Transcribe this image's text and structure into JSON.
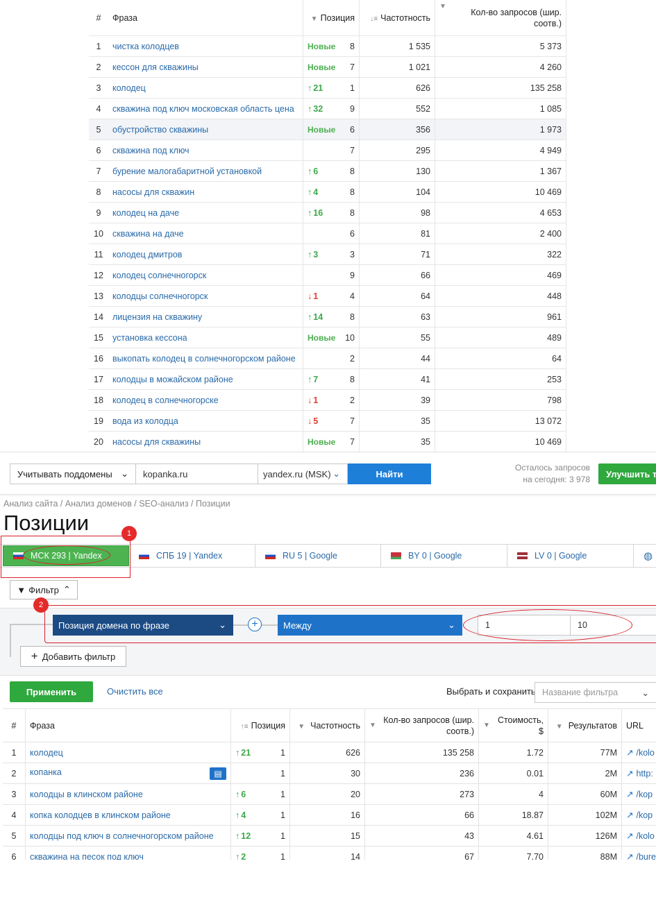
{
  "top_table": {
    "headers": {
      "num": "#",
      "phrase": "Фраза",
      "position": "Позиция",
      "frequency": "Частотность",
      "requests": "Кол-во запросов (шир. соотв.)"
    },
    "rows": [
      {
        "n": "1",
        "phrase": "чистка колодцев",
        "change": "Новые",
        "kind": "new",
        "pos": "8",
        "freq": "1 535",
        "req": "5 373"
      },
      {
        "n": "2",
        "phrase": "кессон для скважины",
        "change": "Новые",
        "kind": "new",
        "pos": "7",
        "freq": "1 021",
        "req": "4 260"
      },
      {
        "n": "3",
        "phrase": "колодец",
        "change": "21",
        "kind": "up",
        "pos": "1",
        "freq": "626",
        "req": "135 258"
      },
      {
        "n": "4",
        "phrase": "скважина под ключ московская область цена",
        "change": "32",
        "kind": "up",
        "pos": "9",
        "freq": "552",
        "req": "1 085"
      },
      {
        "n": "5",
        "phrase": "обустройство скважины",
        "change": "Новые",
        "kind": "new",
        "pos": "6",
        "freq": "356",
        "req": "1 973",
        "hl": true
      },
      {
        "n": "6",
        "phrase": "скважина под ключ",
        "change": "",
        "kind": "none",
        "pos": "7",
        "freq": "295",
        "req": "4 949"
      },
      {
        "n": "7",
        "phrase": "бурение малогабаритной установкой",
        "change": "6",
        "kind": "up",
        "pos": "8",
        "freq": "130",
        "req": "1 367"
      },
      {
        "n": "8",
        "phrase": "насосы для скважин",
        "change": "4",
        "kind": "up",
        "pos": "8",
        "freq": "104",
        "req": "10 469"
      },
      {
        "n": "9",
        "phrase": "колодец на даче",
        "change": "16",
        "kind": "up",
        "pos": "8",
        "freq": "98",
        "req": "4 653"
      },
      {
        "n": "10",
        "phrase": "скважина на даче",
        "change": "",
        "kind": "none",
        "pos": "6",
        "freq": "81",
        "req": "2 400"
      },
      {
        "n": "11",
        "phrase": "колодец дмитров",
        "change": "3",
        "kind": "up",
        "pos": "3",
        "freq": "71",
        "req": "322"
      },
      {
        "n": "12",
        "phrase": "колодец солнечногорск",
        "change": "",
        "kind": "none",
        "pos": "9",
        "freq": "66",
        "req": "469"
      },
      {
        "n": "13",
        "phrase": "колодцы солнечногорск",
        "change": "1",
        "kind": "down",
        "pos": "4",
        "freq": "64",
        "req": "448"
      },
      {
        "n": "14",
        "phrase": "лицензия на скважину",
        "change": "14",
        "kind": "up",
        "pos": "8",
        "freq": "63",
        "req": "961"
      },
      {
        "n": "15",
        "phrase": "установка кессона",
        "change": "Новые",
        "kind": "new",
        "pos": "10",
        "freq": "55",
        "req": "489"
      },
      {
        "n": "16",
        "phrase": "выкопать колодец в солнечногорском районе",
        "change": "",
        "kind": "none",
        "pos": "2",
        "freq": "44",
        "req": "64"
      },
      {
        "n": "17",
        "phrase": "колодцы в можайском районе",
        "change": "7",
        "kind": "up",
        "pos": "8",
        "freq": "41",
        "req": "253"
      },
      {
        "n": "18",
        "phrase": "колодец в солнечногорске",
        "change": "1",
        "kind": "down",
        "pos": "2",
        "freq": "39",
        "req": "798"
      },
      {
        "n": "19",
        "phrase": "вода из колодца",
        "change": "5",
        "kind": "down",
        "pos": "7",
        "freq": "35",
        "req": "13 072"
      },
      {
        "n": "20",
        "phrase": "насосы для скважины",
        "change": "Новые",
        "kind": "new",
        "pos": "7",
        "freq": "35",
        "req": "10 469"
      }
    ]
  },
  "search_bar": {
    "subdomains_label": "Учитывать поддомены",
    "domain_value": "kopanka.ru",
    "engine_value": "yandex.ru (MSK)",
    "find_label": "Найти",
    "remaining_line1": "Осталось запросов",
    "remaining_line2": "на сегодня: 3 978",
    "improve_label": "Улучшить та"
  },
  "breadcrumb": "Анализ сайта / Анализ доменов / SEO-анализ / Позиции",
  "page_title": "Позиции",
  "region_tabs": [
    {
      "label": "МСК 293 | Yandex",
      "flag": "ru",
      "active": true
    },
    {
      "label": "СПБ 19 | Yandex",
      "flag": "ru",
      "active": false
    },
    {
      "label": "RU 5 | Google",
      "flag": "ru",
      "active": false
    },
    {
      "label": "BY 0 | Google",
      "flag": "by",
      "active": false
    },
    {
      "label": "LV 0 | Google",
      "flag": "lv",
      "active": false
    }
  ],
  "annotations": {
    "badge1": "1",
    "badge2": "2",
    "color": "#d8202a"
  },
  "filter": {
    "toggle_label": "Фильтр",
    "field_value": "Позиция домена по фразе",
    "operator_value": "Между",
    "from_value": "1",
    "to_value": "10",
    "add_label": "Добавить фильтр",
    "apply_label": "Применить",
    "clear_label": "Очистить все",
    "save_label": "Выбрать и сохранить",
    "name_placeholder": "Название фильтра"
  },
  "bottom_table": {
    "headers": {
      "num": "#",
      "phrase": "Фраза",
      "position": "Позиция",
      "frequency": "Частотность",
      "requests": "Кол-во запросов (шир. соотв.)",
      "cost": "Стоимость, $",
      "results": "Результатов",
      "url": "URL"
    },
    "rows": [
      {
        "n": "1",
        "phrase": "колодец",
        "change": "21",
        "kind": "up",
        "pos": "1",
        "freq": "626",
        "req": "135 258",
        "cost": "1.72",
        "res": "77M",
        "url": "/kolo"
      },
      {
        "n": "2",
        "phrase": "копанка",
        "change": "",
        "kind": "map",
        "pos": "1",
        "freq": "30",
        "req": "236",
        "cost": "0.01",
        "res": "2M",
        "url": "http:"
      },
      {
        "n": "3",
        "phrase": "колодцы в клинском районе",
        "change": "6",
        "kind": "up",
        "pos": "1",
        "freq": "20",
        "req": "273",
        "cost": "4",
        "res": "60M",
        "url": "/kop"
      },
      {
        "n": "4",
        "phrase": "копка колодцев в клинском районе",
        "change": "4",
        "kind": "up",
        "pos": "1",
        "freq": "16",
        "req": "66",
        "cost": "18.87",
        "res": "102M",
        "url": "/kop"
      },
      {
        "n": "5",
        "phrase": "колодцы под ключ в солнечногорском районе",
        "change": "12",
        "kind": "up",
        "pos": "1",
        "freq": "15",
        "req": "43",
        "cost": "4.61",
        "res": "126M",
        "url": "/kolo"
      },
      {
        "n": "6",
        "phrase": "скважина на песок под ключ",
        "change": "2",
        "kind": "up",
        "pos": "1",
        "freq": "14",
        "req": "67",
        "cost": "7.70",
        "res": "88M",
        "url": "/bure"
      }
    ]
  }
}
